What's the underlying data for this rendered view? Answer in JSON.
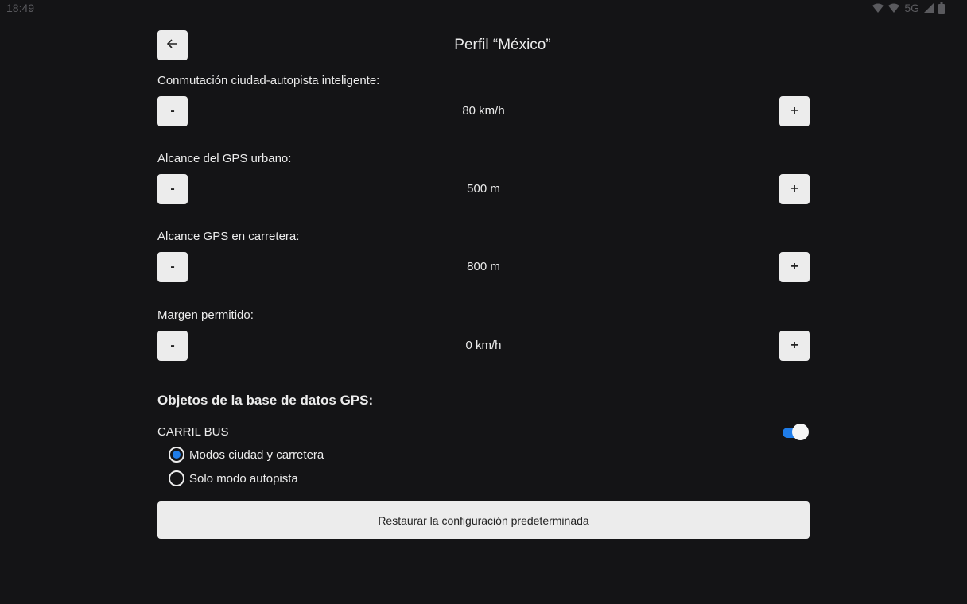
{
  "status_bar": {
    "time": "18:49",
    "network": "5G"
  },
  "header": {
    "back_icon": "arrow-left-icon",
    "title": "Perfil “México”"
  },
  "settings": [
    {
      "label": "Conmutación ciudad-autopista inteligente:",
      "value": "80 km/h",
      "minus": "-",
      "plus": "+"
    },
    {
      "label": "Alcance del GPS urbano:",
      "value": "500 m",
      "minus": "-",
      "plus": "+"
    },
    {
      "label": "Alcance GPS en carretera:",
      "value": "800 m",
      "minus": "-",
      "plus": "+"
    },
    {
      "label": "Margen permitido:",
      "value": "0 km/h",
      "minus": "-",
      "plus": "+"
    }
  ],
  "gps_objects": {
    "title": "Objetos de la base de datos GPS:",
    "bus_lane_label": "CARRIL BUS",
    "bus_lane_enabled": true,
    "options": [
      {
        "label": "Modos ciudad y carretera",
        "selected": true
      },
      {
        "label": "Solo modo autopista",
        "selected": false
      }
    ]
  },
  "restore_button": "Restaurar la configuración predeterminada",
  "colors": {
    "background": "#141416",
    "accent": "#1f7ce8",
    "button_bg": "#ececec"
  }
}
